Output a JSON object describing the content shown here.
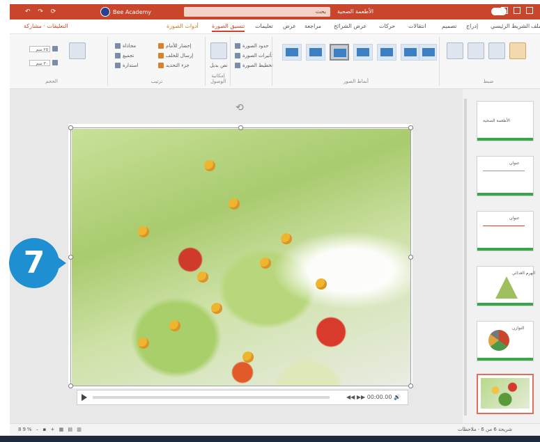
{
  "titlebar": {
    "quick_access": "↶ ↷ ⟳",
    "user_name": "Bee Academy",
    "search_text": "بحث",
    "document_title": "الأطعمة الصحية",
    "colors": {
      "accent": "#c9452c"
    }
  },
  "tabs": {
    "items": [
      "ملف",
      "الشريط الرئيسي",
      "إدراج",
      "تصميم",
      "انتقالات",
      "حركات",
      "عرض الشرائح",
      "مراجعة",
      "عرض",
      "تعليمات",
      "تنسيق الصورة"
    ],
    "active": "تنسيق الصورة",
    "share": "مشاركة",
    "comments": "التعليقات"
  },
  "ribbon": {
    "group_adjust": "ضبط",
    "group_styles": "أنماط الصور",
    "group_arrange": "ترتيب",
    "group_size": "الحجم",
    "group_access": "إمكانية الوصول",
    "effects_items": [
      "حدود الصورة",
      "تأثيرات الصورة",
      "تخطيط الصورة"
    ],
    "arrange_items": [
      "إحضار للأمام",
      "إرسال للخلف",
      "جزء التحديد"
    ],
    "size_height": "٢٥ سم",
    "size_width": "٣٠ سم",
    "alt_text": "نص بديل"
  },
  "slide": {
    "step_number": "7",
    "player_controls": "◀◀  ▶▶  00:00.00  🔊"
  },
  "thumbnails": [
    {
      "title": "الأطعمة الصحية"
    },
    {
      "title": "عنوان"
    },
    {
      "title": "عنوان"
    },
    {
      "title": "الهرم الغذائي"
    },
    {
      "title": "التوازن"
    },
    {
      "title": ""
    }
  ],
  "statusbar": {
    "left": "شريحة 6 من 6",
    "right": "ملاحظات",
    "zoom": "89%"
  }
}
